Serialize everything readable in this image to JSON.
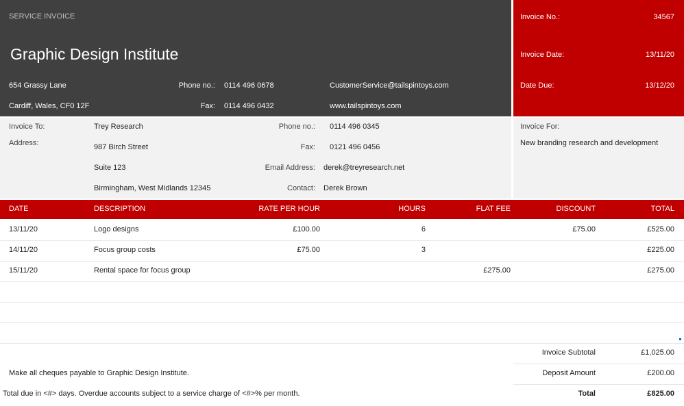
{
  "company": {
    "doc_type": "SERVICE INVOICE",
    "name": "Graphic Design Institute",
    "address1": "654 Grassy Lane",
    "address2": "Cardiff, Wales, CF0 12F",
    "phone_label": "Phone no.:",
    "phone": "0114 496 0678",
    "fax_label": "Fax:",
    "fax": "0114 496 0432",
    "email": "CustomerService@tailspintoys.com",
    "web": "www.tailspintoys.com"
  },
  "invoice": {
    "no_label": "Invoice No.:",
    "no": "34567",
    "date_label": "Invoice Date:",
    "date": "13/11/20",
    "due_label": "Date Due:",
    "due": "13/12/20"
  },
  "client": {
    "to_label": "Invoice To:",
    "address_label": "Address:",
    "name": "Trey Research",
    "addr1": "987 Birch Street",
    "addr2": "Suite 123",
    "addr3": "Birmingham, West Midlands 12345",
    "phone_label": "Phone no.:",
    "phone": "0114 496 0345",
    "fax_label": "Fax:",
    "fax": "0121 496 0456",
    "email_label": "Email Address:",
    "email": "derek@treyresearch.net",
    "contact_label": "Contact:",
    "contact": "Derek Brown",
    "for_label": "Invoice For:",
    "for": "New branding research and development"
  },
  "table": {
    "headers": [
      "DATE",
      "DESCRIPTION",
      "RATE PER HOUR",
      "HOURS",
      "FLAT FEE",
      "DISCOUNT",
      "TOTAL"
    ],
    "rows": [
      [
        "13/11/20",
        "Logo designs",
        "£100.00",
        "6",
        "",
        "£75.00",
        "£525.00"
      ],
      [
        "14/11/20",
        "Focus group costs",
        "£75.00",
        "3",
        "",
        "",
        "£225.00"
      ],
      [
        "15/11/20",
        "Rental space for focus group",
        "",
        "",
        "£275.00",
        "",
        "£275.00"
      ]
    ]
  },
  "footer": {
    "note1": "Make all cheques payable to Graphic Design Institute.",
    "note2": "Total due in <#> days. Overdue accounts subject to a service charge of <#>% per month."
  },
  "totals": {
    "subtotal_label": "Invoice Subtotal",
    "subtotal": "£1,025.00",
    "deposit_label": "Deposit Amount",
    "deposit": "£200.00",
    "total_label": "Total",
    "total": "£825.00"
  },
  "colors": {
    "header_bg": "#404040",
    "accent": "#c00000",
    "panel_bg": "#f2f2f2"
  }
}
